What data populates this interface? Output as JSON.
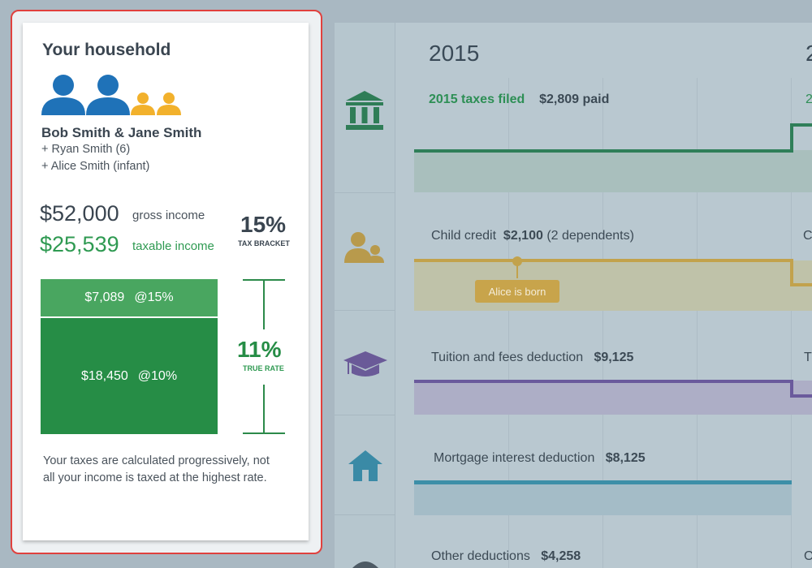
{
  "household": {
    "title": "Your household",
    "names_main": "Bob Smith & Jane Smith",
    "members": [
      "+ Ryan Smith (6)",
      "+ Alice Smith (infant)"
    ],
    "gross_income": "$52,000",
    "gross_income_label": "gross income",
    "taxable_income": "$25,539",
    "taxable_income_label": "taxable income",
    "tax_bracket": "15%",
    "tax_bracket_label": "TAX BRACKET",
    "true_rate": "11%",
    "true_rate_label": "TRUE RATE",
    "tiers": [
      {
        "amount": "$7,089",
        "rate": "@15%"
      },
      {
        "amount": "$18,450",
        "rate": "@10%"
      }
    ],
    "note": "Your taxes are calculated progressively, not all your income is taxed at the highest rate.",
    "icons": [
      "adult-icon",
      "adult-icon",
      "child-icon",
      "child-icon"
    ]
  },
  "timeline": {
    "years": [
      "2015",
      "2"
    ],
    "rows": [
      {
        "icon": "bank-icon",
        "label": "2015 taxes filed",
        "value": "$2,809 paid",
        "next": "2",
        "color": "#2d8f55"
      },
      {
        "icon": "family-icon",
        "label": "Child credit",
        "value": "$2,100",
        "extra": "(2 dependents)",
        "next": "C",
        "color": "#c8a44b"
      },
      {
        "icon": "graduation-cap-icon",
        "label": "Tuition and fees deduction",
        "value": "$9,125",
        "next": "T",
        "color": "#6b5b9e"
      },
      {
        "icon": "house-icon",
        "label": "Mortgage interest deduction",
        "value": "$8,125",
        "color": "#3d8fa6"
      },
      {
        "icon": "circle-icon",
        "label": "Other deductions",
        "value": "$4,258",
        "next": "O"
      }
    ],
    "event_tooltip": "Alice is born"
  },
  "colors": {
    "accent_green": "#2f9a52",
    "dark_green": "#268d46",
    "light_green": "#49a660",
    "selection_border": "#e0413e",
    "adult_blue": "#1f72b8",
    "child_yellow": "#f2b12c"
  }
}
